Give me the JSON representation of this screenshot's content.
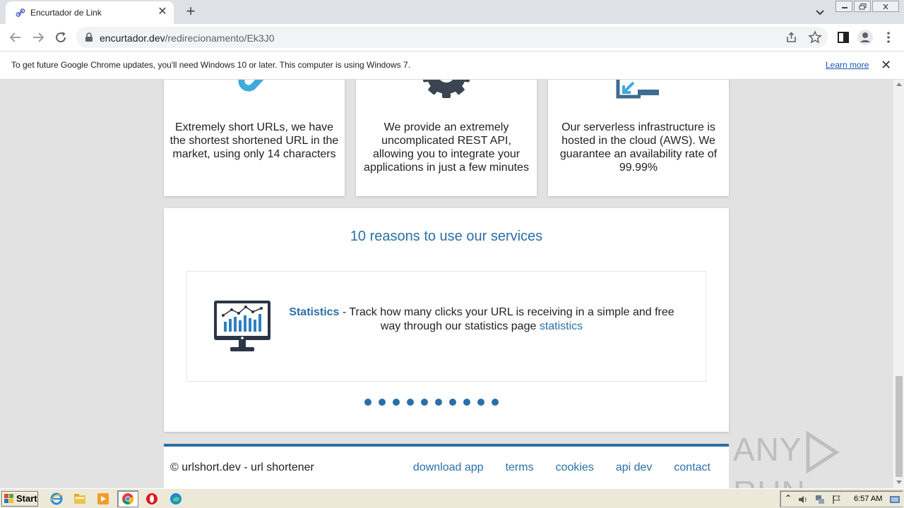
{
  "browser": {
    "tab_title": "Encurtador de Link",
    "url_domain": "encurtador.dev",
    "url_path": "/redirecionamento/Ek3J0",
    "infobar_message": "To get future Google Chrome updates, you'll need Windows 10 or later. This computer is using Windows 7.",
    "infobar_link": "Learn more"
  },
  "features": [
    {
      "icon": "link-icon",
      "text": "Extremely short URLs, we have the shortest shortened URL in the market, using only 14 characters"
    },
    {
      "icon": "gear-icon",
      "text": "We provide an extremely uncomplicated REST API, allowing you to integrate your applications in just a few minutes"
    },
    {
      "icon": "cloud-server-icon",
      "text": "Our serverless infrastructure is hosted in the cloud (AWS). We guarantee an availability rate of 99.99%"
    }
  ],
  "reasons": {
    "title": "10 reasons to use our services",
    "slide": {
      "icon": "monitor-chart-icon",
      "lead": "Statistics",
      "text": " - Track how many clicks your URL is receiving in a simple and free way through our statistics page ",
      "link": "statistics"
    },
    "dot_count": 10
  },
  "footer": {
    "copyright": "© urlshort.dev - url shortener",
    "links": [
      "download app",
      "terms",
      "cookies",
      "api dev",
      "contact"
    ]
  },
  "watermark": {
    "left": "ANY",
    "right": "RUN"
  },
  "taskbar": {
    "start_label": "Start",
    "time": "6:57 AM"
  },
  "colors": {
    "accent": "#2a6fa8",
    "page_bg": "#e2e2e2"
  }
}
